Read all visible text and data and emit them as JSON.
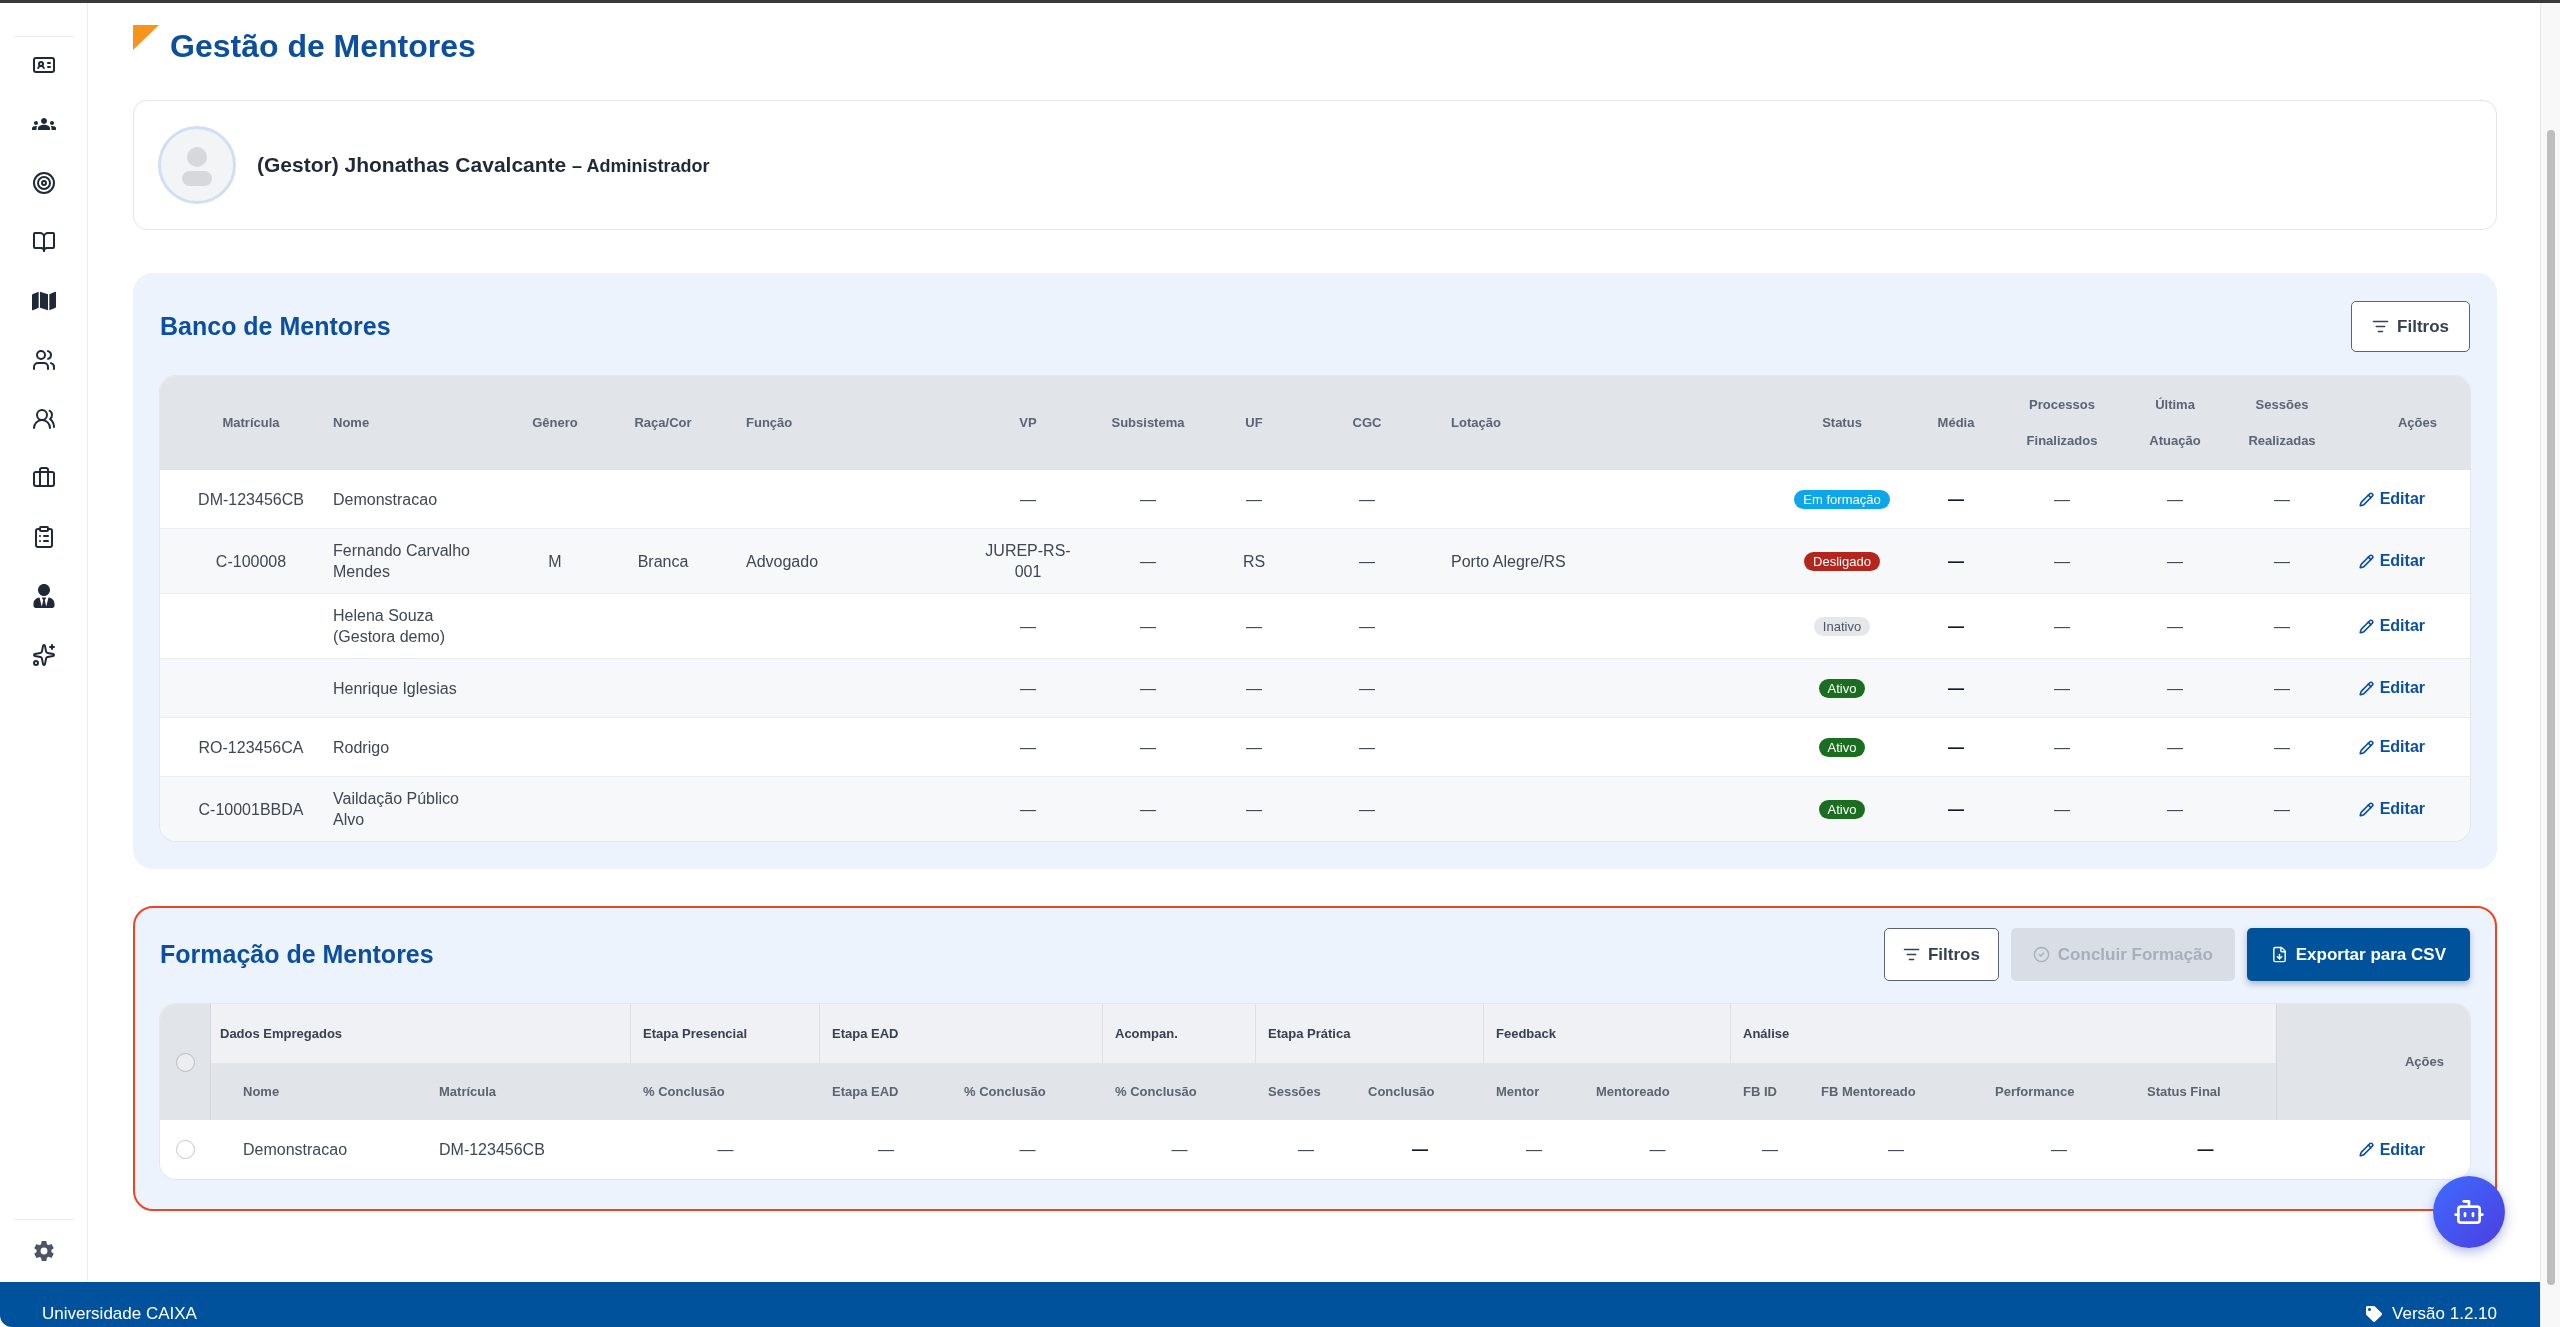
{
  "header": {
    "title": "Gestão de Mentores"
  },
  "profile": {
    "name": "(Gestor) Jhonathas Cavalcante",
    "role": "– Administrador"
  },
  "banco": {
    "title": "Banco de Mentores",
    "highlighted": false,
    "filter_button": {
      "label": "Filtros"
    },
    "table": {
      "columns": [
        "Matrícula",
        "Nome",
        "Gênero",
        "Raça/Cor",
        "Função",
        "VP",
        "Subsistema",
        "UF",
        "CGC",
        "Lotação",
        "Status",
        "Média",
        "Processos Finalizados",
        "Última Atuação",
        "Sessões Realizadas",
        "Ações"
      ],
      "rows": [
        {
          "matricula": "DM-123456CB",
          "nome": "Demonstracao",
          "vp": "—",
          "subsistema": "—",
          "uf": "—",
          "cgc": "—",
          "status": {
            "label": "Em formação",
            "color": "#0ea5e9"
          },
          "media": "—",
          "processos_finalizados": "—",
          "ultima_atuacao": "—",
          "sessoes_realizadas": "—",
          "action": "Editar"
        },
        {
          "matricula": "C-100008",
          "nome": "Fernando Carvalho Mendes",
          "genero": "M",
          "raca_cor": "Branca",
          "funcao": "Advogado",
          "vp": "JUREP-RS-001",
          "subsistema": "—",
          "uf": "RS",
          "cgc": "—",
          "lotacao": "Porto Alegre/RS",
          "status": {
            "label": "Desligado",
            "color": "#b3261e"
          },
          "media": "—",
          "processos_finalizados": "—",
          "ultima_atuacao": "—",
          "sessoes_realizadas": "—",
          "action": "Editar"
        },
        {
          "nome": "Helena Souza (Gestora demo)",
          "vp": "—",
          "subsistema": "—",
          "uf": "—",
          "cgc": "—",
          "status": {
            "label": "Inativo",
            "color": "#e5e7eb"
          },
          "media": "—",
          "processos_finalizados": "—",
          "ultima_atuacao": "—",
          "sessoes_realizadas": "—",
          "action": "Editar"
        },
        {
          "nome": "Henrique Iglesias",
          "vp": "—",
          "subsistema": "—",
          "uf": "—",
          "cgc": "—",
          "status": {
            "label": "Ativo",
            "color": "#1b6e20"
          },
          "media": "—",
          "processos_finalizados": "—",
          "ultima_atuacao": "—",
          "sessoes_realizadas": "—",
          "action": "Editar"
        },
        {
          "matricula": "RO-123456CA",
          "nome": "Rodrigo",
          "vp": "—",
          "subsistema": "—",
          "uf": "—",
          "cgc": "—",
          "status": {
            "label": "Ativo",
            "color": "#1b6e20"
          },
          "media": "—",
          "processos_finalizados": "—",
          "ultima_atuacao": "—",
          "sessoes_realizadas": "—",
          "action": "Editar"
        },
        {
          "matricula": "C-10001BBDA",
          "nome": "Vaildação Público Alvo",
          "vp": "—",
          "subsistema": "—",
          "uf": "—",
          "cgc": "—",
          "status": {
            "label": "Ativo",
            "color": "#1b6e20"
          },
          "media": "—",
          "processos_finalizados": "—",
          "ultima_atuacao": "—",
          "sessoes_realizadas": "—",
          "action": "Editar"
        }
      ]
    }
  },
  "formacao": {
    "title": "Formação de Mentores",
    "highlighted": true,
    "buttons": [
      {
        "kind": "outline",
        "label": "Filtros",
        "disabled": false
      },
      {
        "kind": "muted",
        "label": "Concluir Formação",
        "disabled": true
      },
      {
        "kind": "solid",
        "label": "Exportar para CSV",
        "disabled": false
      }
    ],
    "table": {
      "select_all": {
        "checked": false
      },
      "groups": [
        {
          "label": "Dados Empregados",
          "columns": [
            "Nome",
            "Matrícula"
          ]
        },
        {
          "label": "Etapa Presencial",
          "columns": [
            "% Conclusão"
          ]
        },
        {
          "label": "Etapa EAD",
          "columns": [
            "Etapa EAD",
            "% Conclusão"
          ]
        },
        {
          "label": "Acompan.",
          "columns": [
            "% Conclusão"
          ]
        },
        {
          "label": "Etapa Prática",
          "columns": [
            "Sessões",
            "Conclusão"
          ]
        },
        {
          "label": "Feedback",
          "columns": [
            "Mentor",
            "Mentoreado"
          ]
        },
        {
          "label": "Análise",
          "columns": [
            "FB ID",
            "FB Mentoreado",
            "Performance",
            "Status Final"
          ]
        }
      ],
      "actions_column": "Ações",
      "rows": [
        {
          "selected": false,
          "cells": [
            "Demonstracao",
            "DM-123456CB",
            "—",
            "—",
            "—",
            "—",
            "—",
            "—",
            "—",
            "—",
            "—",
            "—",
            "—",
            "—"
          ],
          "action": "Editar"
        }
      ]
    }
  },
  "footer": {
    "left": "Universidade CAIXA",
    "version": "Versão 1.2.10"
  }
}
